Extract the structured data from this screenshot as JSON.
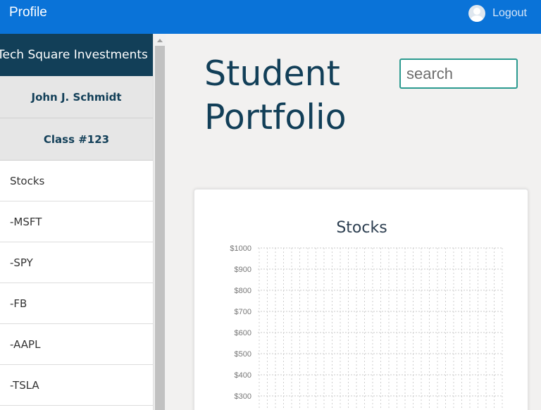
{
  "topbar": {
    "brand": "Profile",
    "logout_label": "Logout"
  },
  "sidebar": {
    "org": "Tech Square Investments",
    "student": "John J. Schmidt",
    "class": "Class #123",
    "items": [
      {
        "label": "Stocks"
      },
      {
        "label": "-MSFT"
      },
      {
        "label": "-SPY"
      },
      {
        "label": "-FB"
      },
      {
        "label": "-AAPL"
      },
      {
        "label": "-TSLA"
      }
    ]
  },
  "main": {
    "title_line1": "Student",
    "title_line2": "Portfolio",
    "search_placeholder": "search"
  },
  "colors": {
    "topbar": "#0a73d8",
    "sidebar_header": "#123f58",
    "accent": "#2b9a8f"
  },
  "chart_data": {
    "type": "line",
    "title": "Stocks",
    "y_tick_labels": [
      "$1000",
      "$900",
      "$800",
      "$700",
      "$600",
      "$500",
      "$400",
      "$300"
    ],
    "ylim": [
      300,
      1000
    ],
    "grid": true,
    "series": []
  }
}
